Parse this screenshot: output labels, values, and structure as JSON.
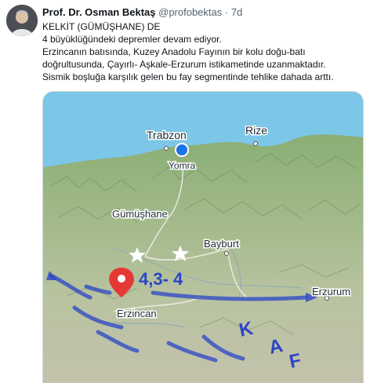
{
  "tweet": {
    "author_name": "Prof. Dr. Osman Bektaş",
    "handle": "@profobektas",
    "separator": "·",
    "time": "7d",
    "lines": [
      "KELKİT (GÜMÜŞHANE) DE",
      "4 büyüklüğündeki depremler devam ediyor.",
      "Erzincanın batısında, Kuzey Anadolu Fayının bir kolu doğu-batı",
      "doğrultusunda, Çayırlı- Aşkale-Erzurum istikametinde uzanmaktadır.",
      "Sismik boşluğa karşılık gelen bu fay segmentinde tehlike dahada arttı."
    ]
  },
  "map": {
    "cities": {
      "trabzon": "Trabzon",
      "rize": "Rize",
      "yomra": "Yomra",
      "gumushane": "Gümüşhane",
      "bayburt": "Bayburt",
      "erzincan": "Erzincan",
      "erzurum": "Erzurum"
    },
    "magnitude_label": "4,3- 4",
    "fault_letters": [
      "K",
      "A",
      "F"
    ],
    "colors": {
      "sea": "#7cc6e8",
      "terrain": "#a9bf8e",
      "annotation": "#2b45c8",
      "pin": "#e53935",
      "location_dot": "#1a73e8"
    }
  }
}
